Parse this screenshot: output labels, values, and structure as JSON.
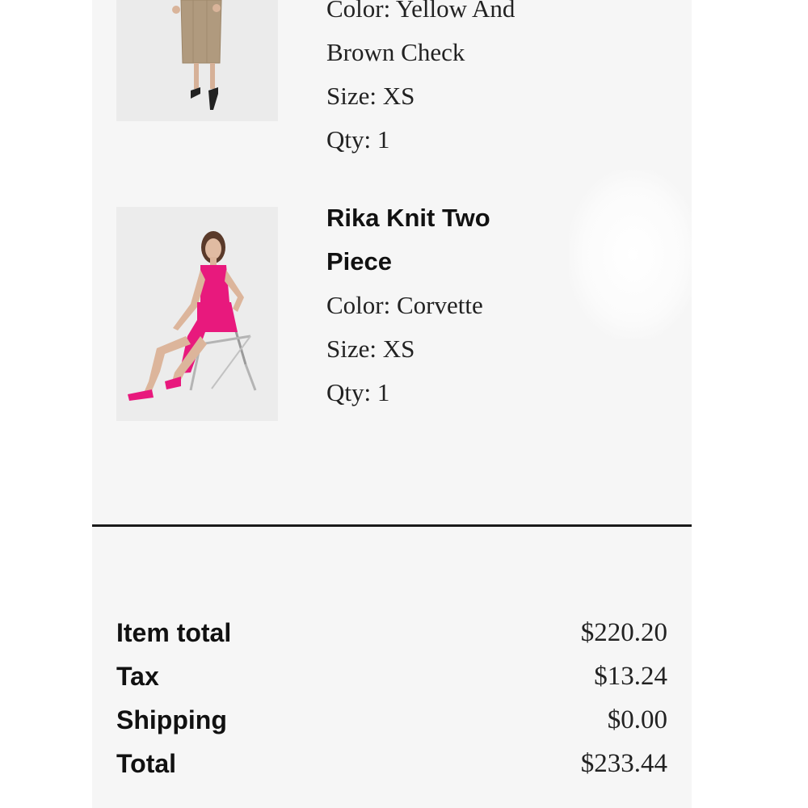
{
  "cart": {
    "items": [
      {
        "name": "",
        "color_line": "Color: Yellow And",
        "color_line2": "Brown Check",
        "size_line": "Size: XS",
        "qty_line": "Qty: 1",
        "image": "woman-in-brown-check-skirt"
      },
      {
        "name_line1": "Rika Knit Two",
        "name_line2": "Piece",
        "color_line": "Color: Corvette",
        "size_line": "Size: XS",
        "qty_line": "Qty: 1",
        "image": "woman-in-pink-two-piece-on-chair"
      }
    ]
  },
  "summary": {
    "rows": [
      {
        "label": "Item total",
        "value": "$220.20"
      },
      {
        "label": "Tax",
        "value": "$13.24"
      },
      {
        "label": "Shipping",
        "value": "$0.00"
      },
      {
        "label": "Total",
        "value": "$233.44"
      }
    ]
  },
  "colors": {
    "panel_bg": "#f6f6f6",
    "divider": "#1a1a1a",
    "accent_pink": "#e8197d"
  }
}
